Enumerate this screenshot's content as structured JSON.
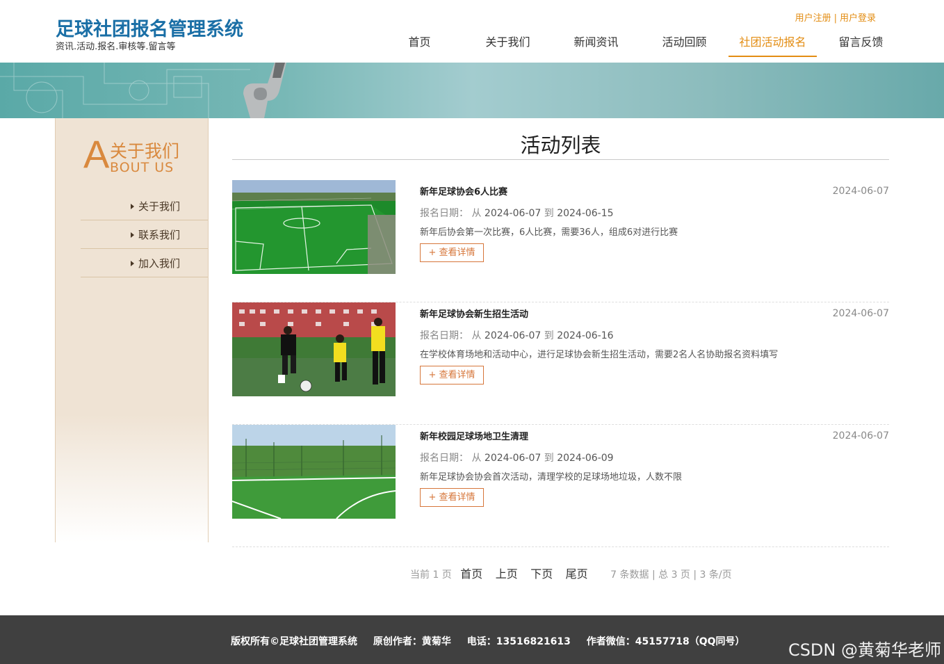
{
  "header": {
    "site_title": "足球社团报名管理系统",
    "site_subtitle": "资讯.活动.报名.审核等.留言等",
    "register_link": "用户注册",
    "login_link": "用户登录",
    "link_separator": "|",
    "nav": [
      {
        "label": "首页"
      },
      {
        "label": "关于我们"
      },
      {
        "label": "新闻资讯"
      },
      {
        "label": "活动回顾"
      },
      {
        "label": "社团活动报名",
        "active": true
      },
      {
        "label": "留言反馈"
      }
    ]
  },
  "sidebar": {
    "big_letter": "A",
    "title_cn": "关于我们",
    "title_en": "BOUT US",
    "items": [
      {
        "label": "关于我们"
      },
      {
        "label": "联系我们"
      },
      {
        "label": "加入我们"
      }
    ]
  },
  "main": {
    "page_title": "活动列表",
    "items": [
      {
        "title": "新年足球协会6人比赛",
        "date": "2024-06-07",
        "reg_label": "报名日期：",
        "from_word": "从",
        "start": "2024-06-07",
        "to_word": "到",
        "end": "2024-06-15",
        "desc": "新年后协会第一次比赛，6人比赛，需要36人，组成6对进行比赛",
        "button": "+ 查看详情",
        "image": "football-field-photo"
      },
      {
        "title": "新年足球协会新生招生活动",
        "date": "2024-06-07",
        "reg_label": "报名日期：",
        "from_word": "从",
        "start": "2024-06-07",
        "to_word": "到",
        "end": "2024-06-16",
        "desc": "在学校体育场地和活动中心，进行足球协会新生招生活动，需要2名人名协助报名资料填写",
        "button": "+ 查看详情",
        "image": "football-players-photo"
      },
      {
        "title": "新年校园足球场地卫生清理",
        "date": "2024-06-07",
        "reg_label": "报名日期：",
        "from_word": "从",
        "start": "2024-06-07",
        "to_word": "到",
        "end": "2024-06-09",
        "desc": "新年足球协会协会首次活动，清理学校的足球场地垃圾，人数不限",
        "button": "+ 查看详情",
        "image": "campus-pitch-photo"
      }
    ]
  },
  "pager": {
    "current": "当前 1 页",
    "first": "首页",
    "prev": "上页",
    "next": "下页",
    "last": "尾页",
    "stats": "7 条数据 | 总 3 页 | 3 条/页"
  },
  "footer": {
    "copyright": "版权所有©足球社团管理系统",
    "author": "原创作者：黄菊华",
    "phone": "电话：13516821613",
    "wechat": "作者微信：45157718（QQ同号）"
  },
  "watermark": "CSDN @黄菊华老师"
}
